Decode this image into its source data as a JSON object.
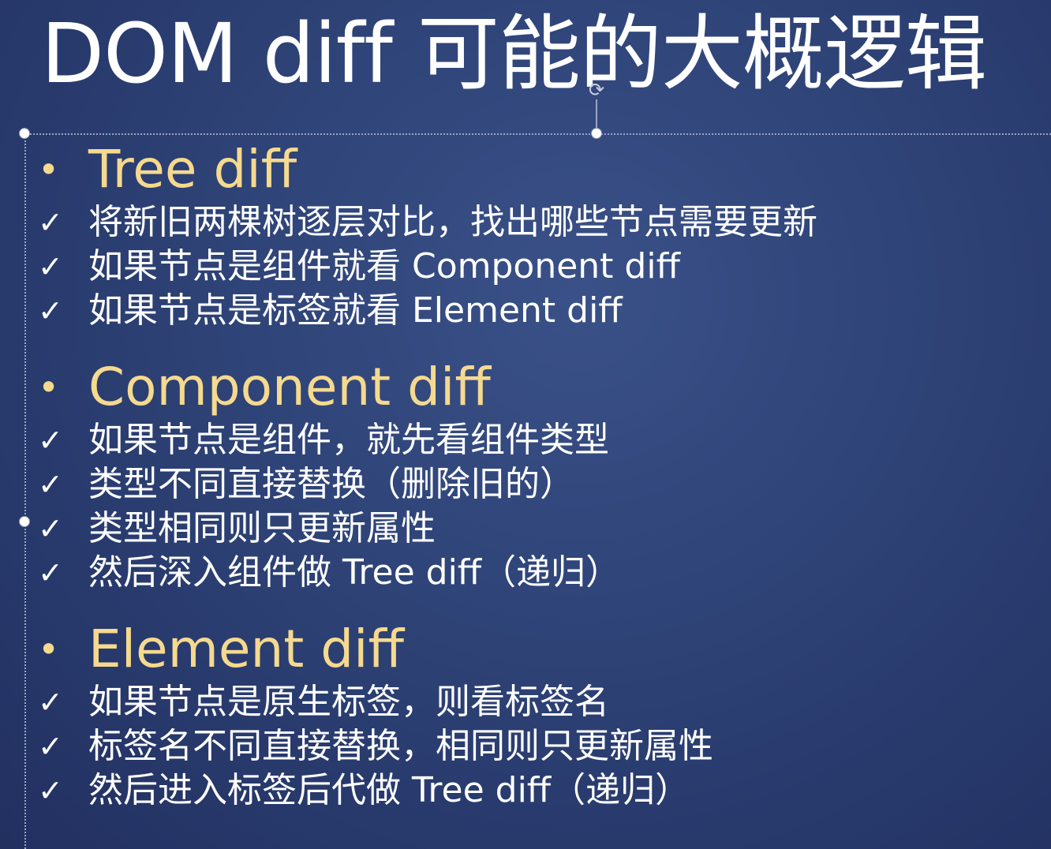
{
  "slide": {
    "title": "DOM diff 可能的大概逻辑",
    "bullet_glyph": "•",
    "check_glyph": "✓",
    "sections": [
      {
        "heading": "Tree diff",
        "items": [
          "将新旧两棵树逐层对比，找出哪些节点需要更新",
          "如果节点是组件就看 Component diff",
          "如果节点是标签就看 Element diff"
        ]
      },
      {
        "heading": "Component diff",
        "items": [
          "如果节点是组件，就先看组件类型",
          "类型不同直接替换（删除旧的）",
          "类型相同则只更新属性",
          "然后深入组件做 Tree diff（递归）"
        ]
      },
      {
        "heading": "Element diff",
        "items": [
          "如果节点是原生标签，则看标签名",
          "标签名不同直接替换，相同则只更新属性",
          "然后进入标签后代做 Tree diff（递归）"
        ]
      }
    ]
  },
  "colors": {
    "background": "#2f4478",
    "heading": "#f5d98e",
    "text": "#ffffff"
  },
  "icons": {
    "rotate_handle": "rotate-icon",
    "check": "checkmark-icon",
    "bullet": "bullet-icon"
  }
}
